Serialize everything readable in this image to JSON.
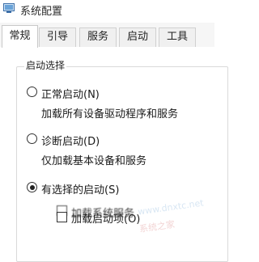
{
  "window": {
    "title": "系统配置",
    "icon": "system-config-icon"
  },
  "tabs": [
    {
      "label": "常规",
      "active": true
    },
    {
      "label": "引导",
      "active": false
    },
    {
      "label": "服务",
      "active": false
    },
    {
      "label": "启动",
      "active": false
    },
    {
      "label": "工具",
      "active": false
    }
  ],
  "startup_selection": {
    "legend": "启动选择",
    "normal": {
      "label": "正常启动(N)",
      "description": "加载所有设备驱动程序和服务",
      "selected": false
    },
    "diagnostic": {
      "label": "诊断启动(D)",
      "description": "仅加载基本设备和服务",
      "selected": false
    },
    "selective": {
      "label": "有选择的启动(S)",
      "selected": true
    },
    "sub_options": [
      {
        "label": "加载系统服务",
        "checked": false
      },
      {
        "label": "加载启动项(O)",
        "checked": false
      }
    ]
  },
  "watermark": {
    "text_a": "www.dnxtc.net",
    "text_b": "系统之家"
  }
}
